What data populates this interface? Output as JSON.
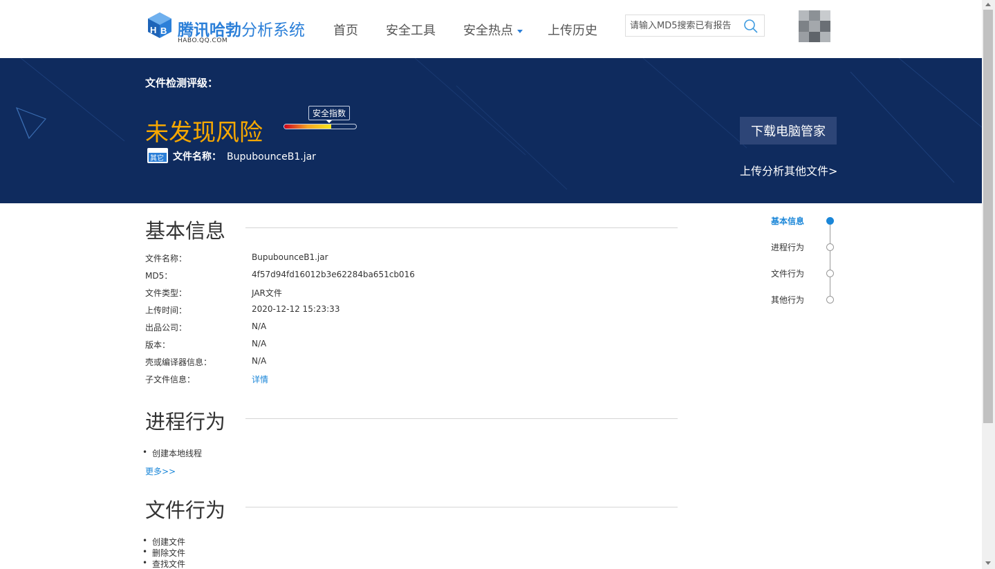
{
  "header": {
    "logo_text_bold": "腾讯哈勃",
    "logo_text": "分析系统",
    "logo_sub": "HABO.QQ.COM",
    "nav": [
      {
        "label": "首页"
      },
      {
        "label": "安全工具"
      },
      {
        "label": "安全热点"
      },
      {
        "label": "上传历史"
      }
    ],
    "search_placeholder": "请输入MD5搜索已有报告"
  },
  "banner": {
    "rating_label": "文件检测评级：",
    "verdict": "未发现风险",
    "safety_tag": "安全指数",
    "safety_level": 0.65,
    "file_icon_text": "其它",
    "file_name_label": "文件名称：",
    "file_name": "BupubounceB1.jar",
    "download_button": "下载电脑管家",
    "upload_link": "上传分析其他文件>"
  },
  "basic_info": {
    "title": "基本信息",
    "rows": [
      {
        "label": "文件名称：",
        "value": "BupubounceB1.jar"
      },
      {
        "label": "MD5：",
        "value": "4f57d94fd16012b3e62284ba651cb016"
      },
      {
        "label": "文件类型：",
        "value": "JAR文件"
      },
      {
        "label": "上传时间：",
        "value": "2020-12-12 15:23:33"
      },
      {
        "label": "出品公司：",
        "value": "N/A"
      },
      {
        "label": "版本：",
        "value": "N/A"
      },
      {
        "label": "壳或编译器信息：",
        "value": "N/A"
      },
      {
        "label": "子文件信息：",
        "value": "详情"
      }
    ]
  },
  "process": {
    "title": "进程行为",
    "items": [
      "创建本地线程"
    ],
    "more": "更多>>"
  },
  "file_behavior": {
    "title": "文件行为",
    "items": [
      "创建文件",
      "删除文件",
      "查找文件"
    ]
  },
  "side_nav": {
    "items": [
      {
        "label": "基本信息"
      },
      {
        "label": "进程行为"
      },
      {
        "label": "文件行为"
      },
      {
        "label": "其他行为"
      }
    ]
  },
  "colors": {
    "brand": "#2b7fd8",
    "banner": "#0f2b5e",
    "verdict": "#f7a800",
    "link": "#1a86d8"
  }
}
